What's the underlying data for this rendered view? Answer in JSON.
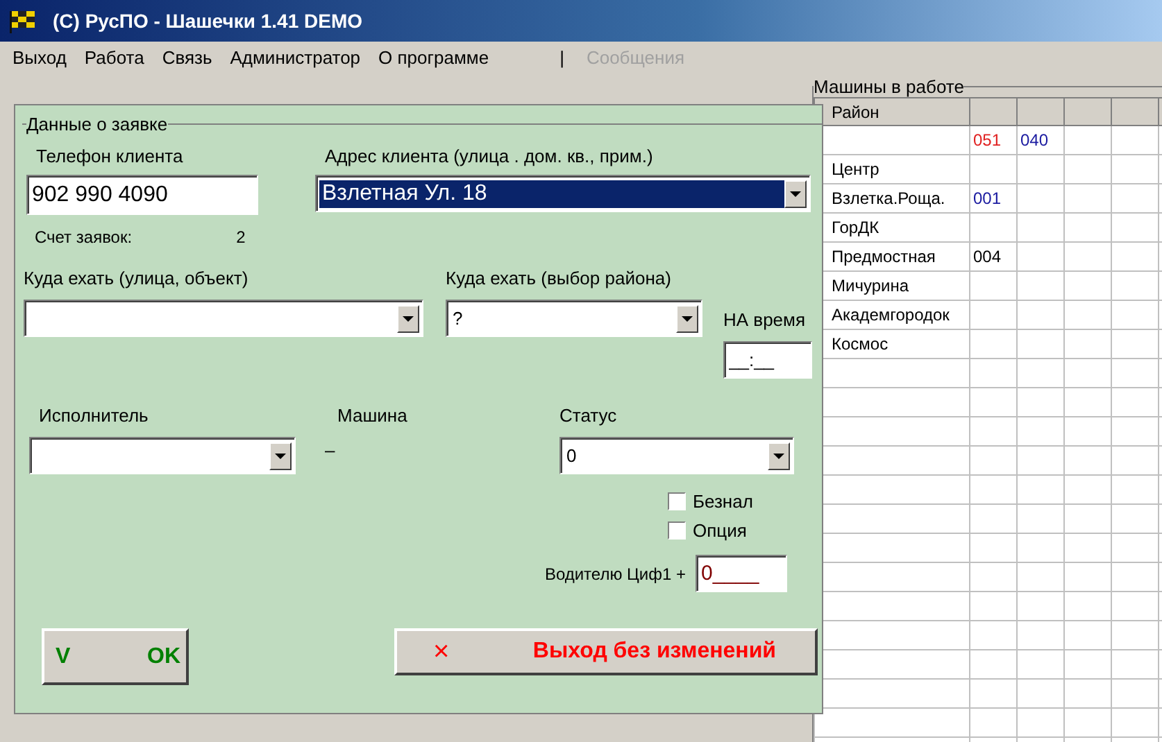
{
  "window": {
    "title": "(C) РусПО - Шашечки 1.41 DEMO"
  },
  "menu": [
    {
      "label": "Выход",
      "disabled": false
    },
    {
      "label": "Работа",
      "disabled": false
    },
    {
      "label": "Связь",
      "disabled": false
    },
    {
      "label": "Администратор",
      "disabled": false
    },
    {
      "label": "О программе",
      "disabled": false
    },
    {
      "label": "Сообщения",
      "disabled": true
    }
  ],
  "menu_divider": "|",
  "order": {
    "group_title": "Данные о заявке",
    "phone": {
      "label": "Телефон клиента",
      "value": "902 990 4090"
    },
    "address": {
      "label": "Адрес клиента (улица . дом. кв., прим.)",
      "value": "Взлетная Ул. 18",
      "selected": true
    },
    "count": {
      "label": "Счет заявок:",
      "value": "2"
    },
    "destination": {
      "label": "Куда ехать (улица, объект)"
    },
    "district": {
      "label": "Куда ехать (выбор района)",
      "value": "?"
    },
    "time": {
      "label": "НА время",
      "value": "__:__"
    },
    "executor": {
      "label": "Исполнитель"
    },
    "car": {
      "label": "Машина",
      "value": "–"
    },
    "status": {
      "label": "Статус",
      "value": "0"
    },
    "options": [
      {
        "label": "Безнал",
        "checked": false
      },
      {
        "label": "Опция",
        "checked": false
      }
    ],
    "driver_code": {
      "label": "Водителю Циф1 +",
      "value": "0____"
    },
    "ok_button": {
      "mark": "V",
      "label": "OK"
    },
    "cancel_button": {
      "mark": "×",
      "label": "Выход  без  изменений"
    }
  },
  "cars": {
    "group_title": "Машины в работе",
    "columns": [
      "Район"
    ],
    "rows": [
      {
        "cells": [
          {
            "text": "051",
            "color": "#e02020"
          },
          {
            "text": "040",
            "color": "#1a1aa0"
          }
        ]
      },
      {
        "district": "Центр",
        "cells": []
      },
      {
        "district": "Взлетка.Роща.",
        "cells": [
          {
            "text": "001",
            "color": "#1a1aa0"
          }
        ]
      },
      {
        "district": "ГорДК",
        "cells": []
      },
      {
        "district": "Предмостная",
        "cells": [
          {
            "text": "004",
            "color": "#000000"
          }
        ]
      },
      {
        "district": "Мичурина",
        "cells": []
      },
      {
        "district": "Академгородок",
        "cells": []
      },
      {
        "district": "Космос",
        "cells": []
      }
    ]
  }
}
